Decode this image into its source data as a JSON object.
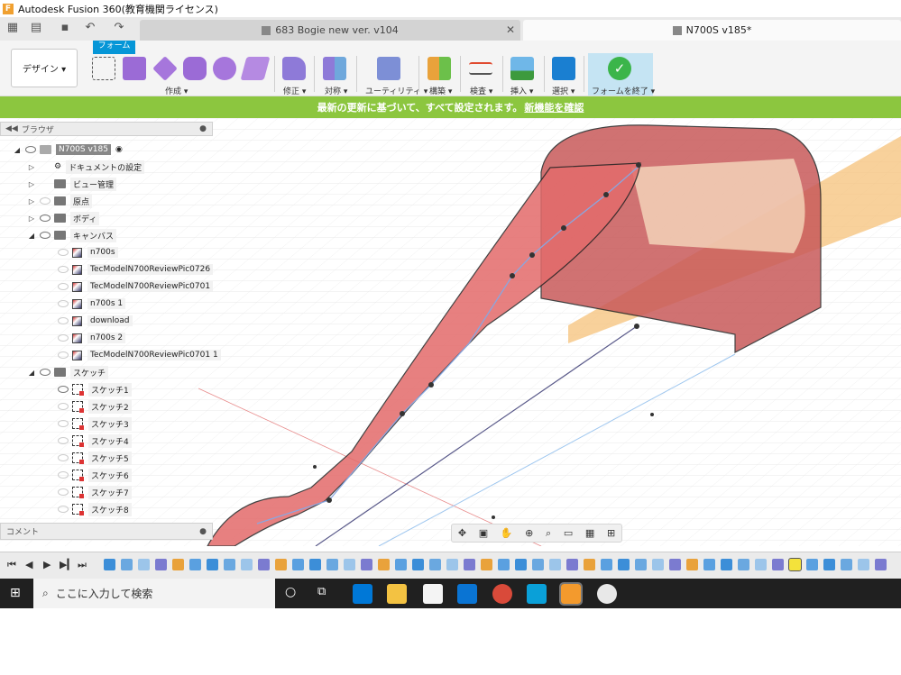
{
  "app": {
    "title": "Autodesk Fusion 360(教育機関ライセンス)",
    "logo_letter": "F"
  },
  "tabs": [
    {
      "label": "683 Bogie new ver. v104",
      "active": false
    },
    {
      "label": "N700S v185*",
      "active": true
    }
  ],
  "ribbon": {
    "workspace_tab": "フォーム",
    "design_button": "デザイン ▾",
    "groups": [
      {
        "label": "作成 ▾"
      },
      {
        "label": "修正 ▾"
      },
      {
        "label": "対称 ▾"
      },
      {
        "label": "ユーティリティ ▾"
      },
      {
        "label": "構築 ▾"
      },
      {
        "label": "検査 ▾"
      },
      {
        "label": "挿入 ▾"
      },
      {
        "label": "選択 ▾"
      },
      {
        "label": "フォームを終了 ▾"
      }
    ]
  },
  "banner": {
    "text": "最新の更新に基づいて、すべて設定されます。",
    "link": "新機能を確認"
  },
  "browser": {
    "title": "ブラウザ",
    "root": "N700S v185",
    "items": [
      {
        "label": "ドキュメントの設定"
      },
      {
        "label": "ビュー管理"
      },
      {
        "label": "原点"
      },
      {
        "label": "ボディ"
      },
      {
        "label": "キャンバス"
      },
      {
        "label": "n700s"
      },
      {
        "label": "TecModelN700ReviewPic0726"
      },
      {
        "label": "TecModelN700ReviewPic0701"
      },
      {
        "label": "n700s 1"
      },
      {
        "label": "download"
      },
      {
        "label": "n700s 2"
      },
      {
        "label": "TecModelN700ReviewPic0701 1"
      },
      {
        "label": "スケッチ"
      },
      {
        "label": "スケッチ1"
      },
      {
        "label": "スケッチ2"
      },
      {
        "label": "スケッチ3"
      },
      {
        "label": "スケッチ4"
      },
      {
        "label": "スケッチ5"
      },
      {
        "label": "スケッチ6"
      },
      {
        "label": "スケッチ7"
      },
      {
        "label": "スケッチ8"
      }
    ]
  },
  "comments": {
    "label": "コメント"
  },
  "taskbar": {
    "search_placeholder": "ここに入力して検索"
  },
  "colors": {
    "banner": "#8cc63f",
    "accent": "#0696d7",
    "body_red": "#e06060",
    "plane_orange": "#f5c27a"
  }
}
